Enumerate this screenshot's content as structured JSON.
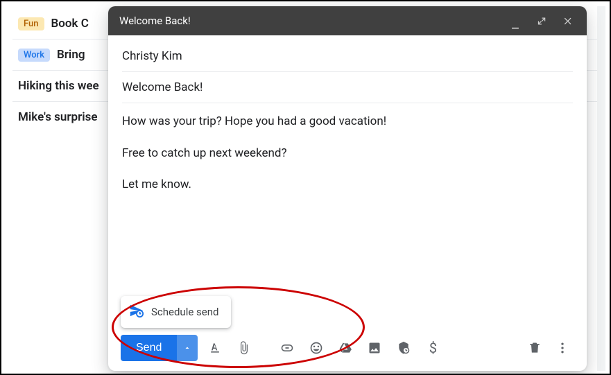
{
  "inbox": {
    "rows": [
      {
        "label": "Fun",
        "labelClass": "label-fun",
        "subject": "Book C"
      },
      {
        "label": "Work",
        "labelClass": "label-work",
        "subject": "Bring"
      },
      {
        "label": null,
        "subject": "Hiking this wee"
      },
      {
        "label": null,
        "subject": "Mike's surprise"
      }
    ]
  },
  "compose": {
    "header_title": "Welcome Back!",
    "recipient": "Christy Kim",
    "subject": "Welcome Back!",
    "body_lines": [
      "How was your trip? Hope you had a good vacation!",
      "Free to catch up next weekend?",
      "Let me know."
    ],
    "send_label": "Send",
    "schedule_label": "Schedule send"
  },
  "toolbar_icons": {
    "format": "format-text-icon",
    "attach": "attach-icon",
    "link": "link-icon",
    "emoji": "emoji-icon",
    "drive": "drive-icon",
    "image": "image-icon",
    "confidential": "confidential-icon",
    "money": "money-icon",
    "discard": "trash-icon",
    "more": "more-vert-icon"
  }
}
